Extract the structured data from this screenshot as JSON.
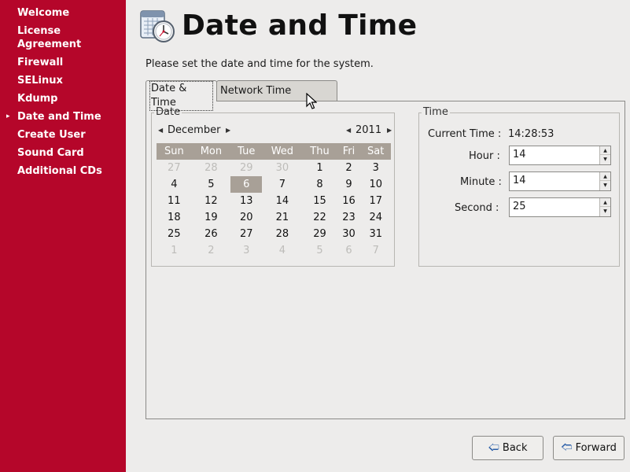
{
  "sidebar": {
    "items": [
      {
        "label": "Welcome"
      },
      {
        "label": "License Agreement"
      },
      {
        "label": "Firewall"
      },
      {
        "label": "SELinux"
      },
      {
        "label": "Kdump"
      },
      {
        "label": "Date and Time",
        "current": true
      },
      {
        "label": "Create User"
      },
      {
        "label": "Sound Card"
      },
      {
        "label": "Additional CDs"
      }
    ]
  },
  "header": {
    "title": "Date and Time",
    "icon": "calendar-clock-icon"
  },
  "instructions": "Please set the date and time for the system.",
  "tabs": [
    {
      "label": "Date & Time",
      "active": true
    },
    {
      "label": "Network Time Protocol",
      "active": false
    }
  ],
  "date": {
    "frame_label": "Date",
    "month": "December",
    "year": "2011",
    "weekdays": [
      "Sun",
      "Mon",
      "Tue",
      "Wed",
      "Thu",
      "Fri",
      "Sat"
    ],
    "weeks": [
      [
        "27",
        "28",
        "29",
        "30",
        "1",
        "2",
        "3"
      ],
      [
        "4",
        "5",
        "6",
        "7",
        "8",
        "9",
        "10"
      ],
      [
        "11",
        "12",
        "13",
        "14",
        "15",
        "16",
        "17"
      ],
      [
        "18",
        "19",
        "20",
        "21",
        "22",
        "23",
        "24"
      ],
      [
        "25",
        "26",
        "27",
        "28",
        "29",
        "30",
        "31"
      ],
      [
        "1",
        "2",
        "3",
        "4",
        "5",
        "6",
        "7"
      ]
    ],
    "selected_day": "6"
  },
  "time": {
    "frame_label": "Time",
    "current_time_label": "Current Time :",
    "current_time_value": "14:28:53",
    "hour_label": "Hour :",
    "hour_value": "14",
    "minute_label": "Minute :",
    "minute_value": "14",
    "second_label": "Second :",
    "second_value": "25"
  },
  "buttons": {
    "back": "Back",
    "forward": "Forward"
  },
  "colors": {
    "sidebar_bg": "#b5062a",
    "window_bg": "#edeceb",
    "calendar_header_bg": "#a8a097",
    "button_icon": "#2a5ea8"
  }
}
